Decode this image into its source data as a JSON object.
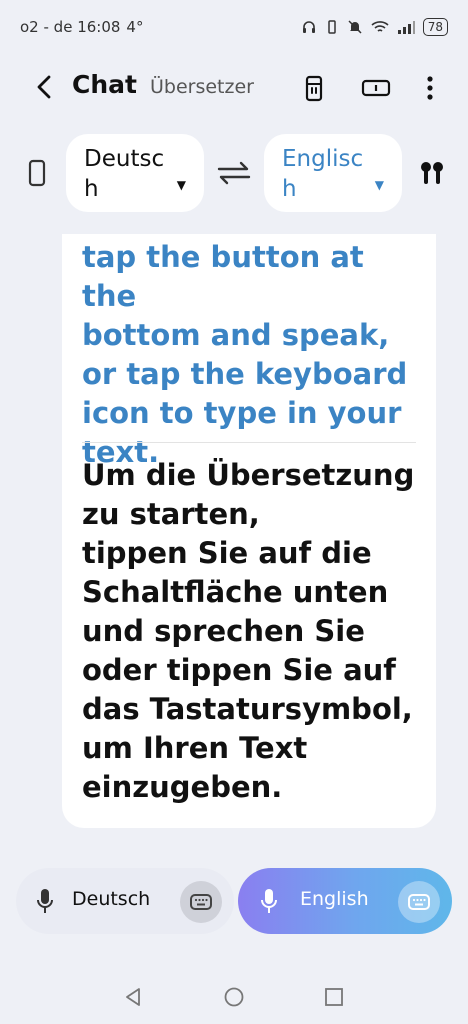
{
  "status_bar": {
    "carrier_time": "o2 - de 16:08",
    "temp": "4°",
    "battery": "78"
  },
  "header": {
    "title": "Chat",
    "subtitle": "Übersetzer"
  },
  "languages": {
    "source_line1": "Deutsc",
    "source_line2": "h",
    "target_line1": "Englisc",
    "target_line2": "h"
  },
  "content": {
    "english_lines": [
      "tap the button at the",
      "bottom and speak,",
      "or tap the keyboard",
      "icon to type in your",
      "text."
    ],
    "german_lines": [
      "Um die Übersetzung",
      "zu starten,",
      "tippen Sie auf die",
      "Schaltfläche unten",
      "und sprechen Sie",
      "oder tippen Sie auf",
      "das Tastatursymbol,",
      "um Ihren Text",
      "einzugeben."
    ]
  },
  "bottom": {
    "left_label": "Deutsch",
    "right_label": "English"
  },
  "colors": {
    "accent_blue": "#3b84c4",
    "background": "#eef0f6"
  },
  "icons": [
    "back-arrow-icon",
    "earbuds-case-icon",
    "screen-icon",
    "more-vert-icon",
    "phone-icon",
    "swap-icon",
    "earbuds-icon",
    "mic-icon",
    "keyboard-icon"
  ]
}
